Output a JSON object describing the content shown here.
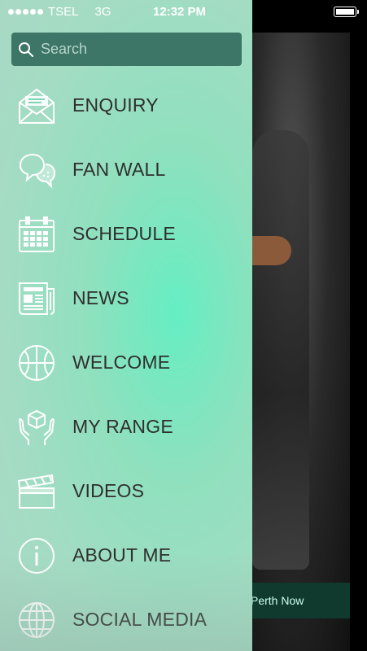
{
  "status_bar": {
    "carrier": "TSEL",
    "network": "3G",
    "time": "12:32 PM"
  },
  "search": {
    "placeholder": "Search",
    "value": ""
  },
  "menu": {
    "items": [
      {
        "label": "ENQUIRY",
        "icon": "envelope-icon"
      },
      {
        "label": "FAN WALL",
        "icon": "chat-bubbles-icon"
      },
      {
        "label": "SCHEDULE",
        "icon": "calendar-icon"
      },
      {
        "label": "NEWS",
        "icon": "newspaper-icon"
      },
      {
        "label": "WELCOME",
        "icon": "basketball-icon"
      },
      {
        "label": "MY RANGE",
        "icon": "hands-box-icon"
      },
      {
        "label": "VIDEOS",
        "icon": "clapperboard-icon"
      },
      {
        "label": "ABOUT ME",
        "icon": "info-icon"
      },
      {
        "label": "SOCIAL MEDIA",
        "icon": "globe-icon"
      }
    ]
  },
  "background": {
    "footer_text": "Perth Now"
  },
  "colors": {
    "drawer_center": "#66eec2",
    "drawer_edge": "#a9d8c4",
    "search_bg": "#3d7566",
    "label_text": "#2f2f2f"
  }
}
